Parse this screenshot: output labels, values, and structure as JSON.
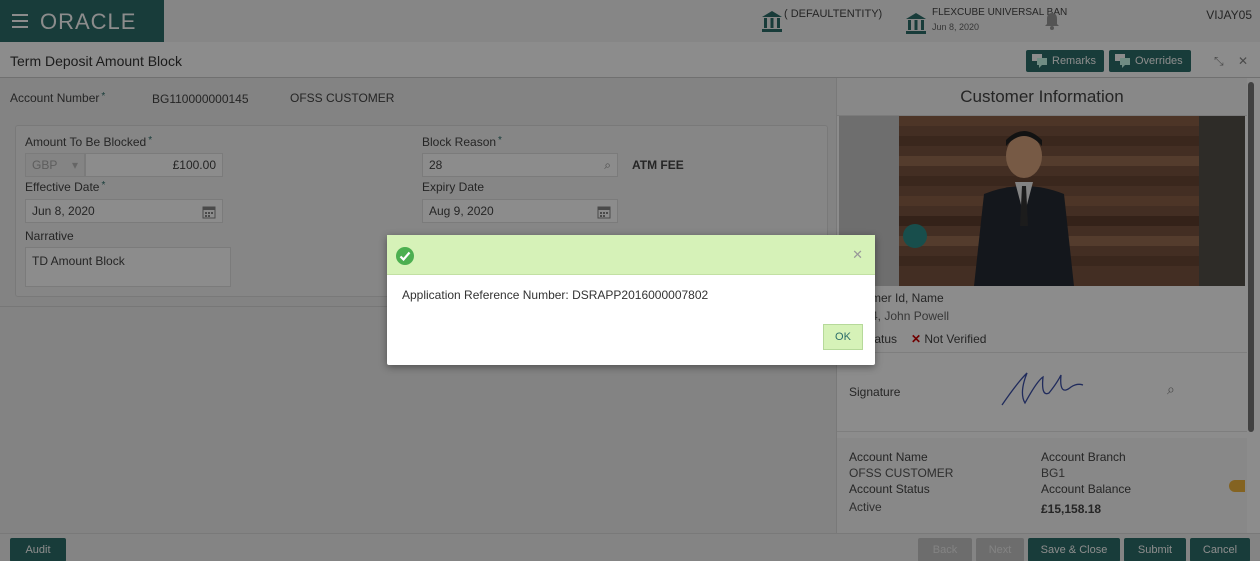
{
  "header": {
    "logo_text": "ORACLE",
    "entity": "( DEFAULTENTITY)",
    "branch_name": "FLEXCUBE UNIVERSAL BAN",
    "branch_date": "Jun 8, 2020",
    "user": "VIJAY05"
  },
  "titlebar": {
    "title": "Term Deposit Amount Block",
    "remarks_label": "Remarks",
    "overrides_label": "Overrides"
  },
  "form": {
    "account_number_label": "Account Number",
    "account_number": "BG110000000145",
    "account_name": "OFSS CUSTOMER",
    "amount_label": "Amount To Be Blocked",
    "currency": "GBP",
    "amount": "£100.00",
    "block_reason_label": "Block Reason",
    "block_reason_code": "28",
    "block_reason_desc": "ATM FEE",
    "effective_date_label": "Effective Date",
    "effective_date": "Jun 8, 2020",
    "expiry_date_label": "Expiry Date",
    "expiry_date": "Aug 9, 2020",
    "narrative_label": "Narrative",
    "narrative": "TD Amount Block"
  },
  "customer": {
    "title": "Customer Information",
    "id_name_label": "mer Id, Name",
    "id_name_value": "4, John Powell",
    "status_label": "tatus",
    "status_value": "Not Verified",
    "signature_label": "Signature",
    "account_name_label": "Account Name",
    "account_name_value": "OFSS CUSTOMER",
    "account_branch_label": "Account Branch",
    "account_branch_value": "BG1",
    "account_status_label": "Account Status",
    "account_status_value": "Active",
    "account_balance_label": "Account Balance",
    "account_balance_value": "£15,158.18"
  },
  "footer": {
    "audit": "Audit",
    "back": "Back",
    "next": "Next",
    "save_close": "Save & Close",
    "submit": "Submit",
    "cancel": "Cancel"
  },
  "modal": {
    "message": "Application Reference Number: DSRAPP2016000007802",
    "ok": "OK"
  },
  "colors": {
    "brand": "#2d6e6a",
    "modal_header": "#d6f2b8",
    "success": "#4caf50"
  }
}
